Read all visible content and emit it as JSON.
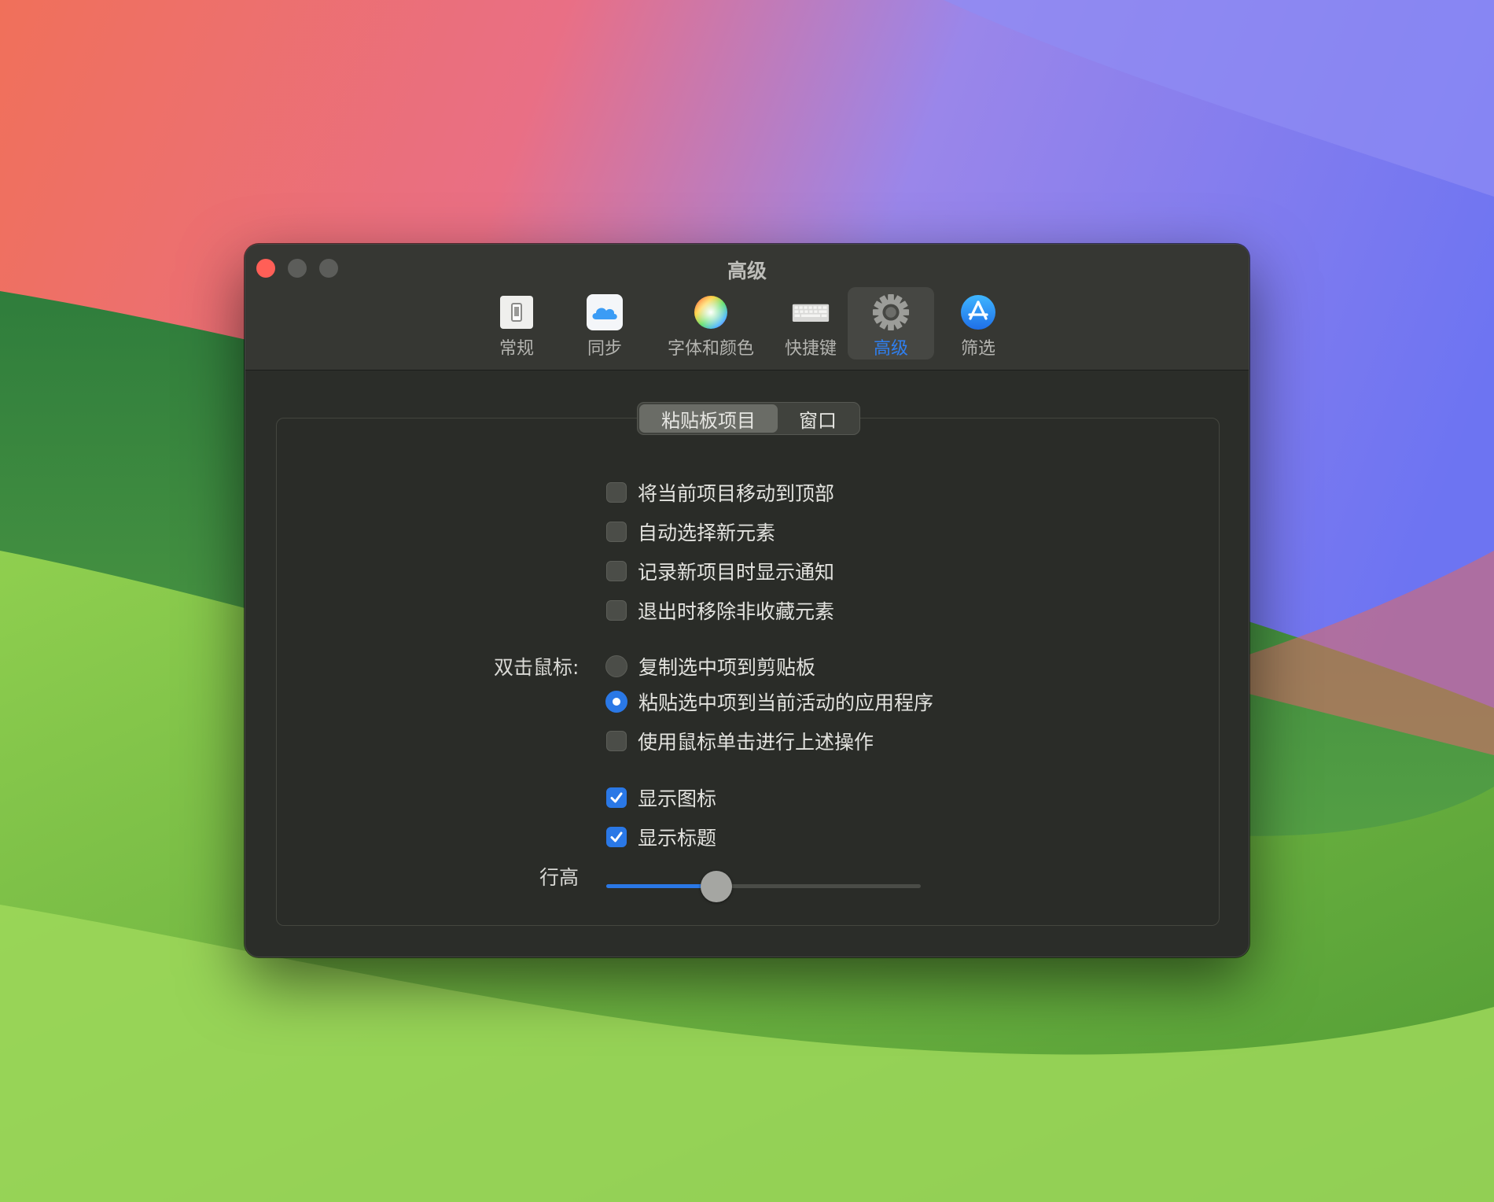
{
  "window": {
    "title": "高级"
  },
  "toolbar": {
    "items": [
      {
        "label": "常规",
        "icon": "switch-icon",
        "active": false
      },
      {
        "label": "同步",
        "icon": "icloud-icon",
        "active": false
      },
      {
        "label": "字体和颜色",
        "icon": "color-wheel-icon",
        "active": false
      },
      {
        "label": "快捷键",
        "icon": "keyboard-icon",
        "active": false
      },
      {
        "label": "高级",
        "icon": "gear-icon",
        "active": true
      },
      {
        "label": "筛选",
        "icon": "app-store-icon",
        "active": false
      }
    ]
  },
  "tabs": {
    "items": [
      {
        "label": "粘贴板项目",
        "selected": true
      },
      {
        "label": "窗口",
        "selected": false
      }
    ]
  },
  "options": {
    "move_to_top": {
      "label": "将当前项目移动到顶部",
      "checked": false
    },
    "auto_select": {
      "label": "自动选择新元素",
      "checked": false
    },
    "notify_new": {
      "label": "记录新项目时显示通知",
      "checked": false
    },
    "remove_on_quit": {
      "label": "退出时移除非收藏元素",
      "checked": false
    },
    "double_click_label": "双击鼠标:",
    "double_click_copy": {
      "label": "复制选中项到剪贴板",
      "selected": false
    },
    "double_click_paste": {
      "label": "粘贴选中项到当前活动的应用程序",
      "selected": true
    },
    "single_click": {
      "label": "使用鼠标单击进行上述操作",
      "checked": false
    },
    "show_icons": {
      "label": "显示图标",
      "checked": true
    },
    "show_titles": {
      "label": "显示标题",
      "checked": true
    },
    "row_height_label": "行高",
    "row_height_value": 0.35
  },
  "colors": {
    "accent": "#2a78e6",
    "close": "#ff5f57",
    "window_bg": "#2b2d29"
  }
}
